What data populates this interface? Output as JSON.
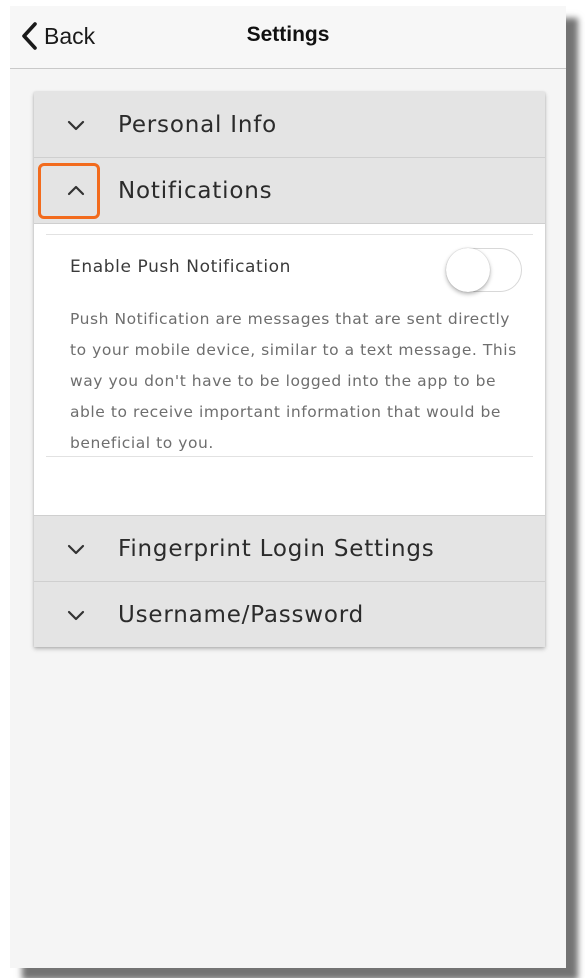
{
  "navbar": {
    "back_label": "Back",
    "title": "Settings",
    "back_icon": "chevron-left-icon"
  },
  "sections": {
    "personal_info": {
      "label": "Personal Info",
      "icon": "chevron-down-icon",
      "expanded": false
    },
    "notifications": {
      "label": "Notifications",
      "icon": "chevron-up-icon",
      "expanded": true,
      "highlight_color": "#f26b1d",
      "push": {
        "label": "Enable Push Notification",
        "enabled": false,
        "description": "Push Notification are messages that are sent directly to your mobile device, similar to a text message. This way you don't have to be logged into the app to be able to receive important information that would be beneficial to you."
      }
    },
    "fingerprint": {
      "label": "Fingerprint Login Settings",
      "icon": "chevron-down-icon",
      "expanded": false
    },
    "credentials": {
      "label": "Username/Password",
      "icon": "chevron-down-icon",
      "expanded": false
    }
  },
  "colors": {
    "header_bg": "#e4e4e4",
    "body_bg": "#ffffff",
    "page_bg": "#f5f5f5"
  }
}
